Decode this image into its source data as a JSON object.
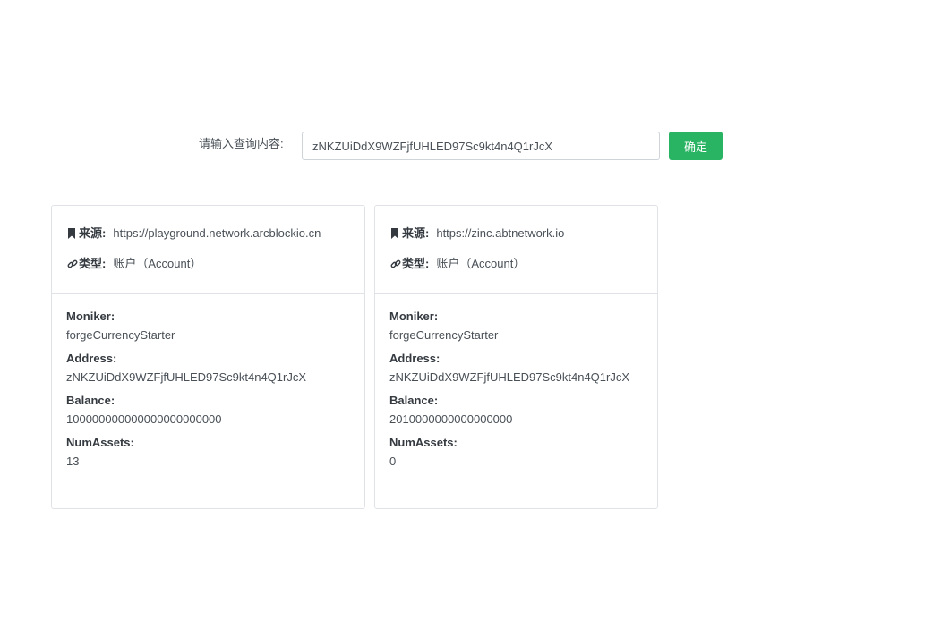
{
  "search": {
    "label": "请输入查询内容:",
    "value": "zNKZUiDdX9WZFjfUHLED97Sc9kt4n4Q1rJcX",
    "button": "确定"
  },
  "cards": [
    {
      "source_key": "来源:",
      "source_val": "https://playground.network.arcblockio.cn",
      "type_key": "类型:",
      "type_val": "账户（Account）",
      "fields": [
        {
          "label": "Moniker:",
          "value": "forgeCurrencyStarter"
        },
        {
          "label": "Address:",
          "value": "zNKZUiDdX9WZFjfUHLED97Sc9kt4n4Q1rJcX"
        },
        {
          "label": "Balance:",
          "value": "100000000000000000000000"
        },
        {
          "label": "NumAssets:",
          "value": "13"
        }
      ]
    },
    {
      "source_key": "来源:",
      "source_val": "https://zinc.abtnetwork.io",
      "type_key": "类型:",
      "type_val": "账户（Account）",
      "fields": [
        {
          "label": "Moniker:",
          "value": "forgeCurrencyStarter"
        },
        {
          "label": "Address:",
          "value": "zNKZUiDdX9WZFjfUHLED97Sc9kt4n4Q1rJcX"
        },
        {
          "label": "Balance:",
          "value": "2010000000000000000"
        },
        {
          "label": "NumAssets:",
          "value": "0"
        }
      ]
    }
  ],
  "icons": {
    "source": "bookmark-icon",
    "type": "link-icon"
  },
  "colors": {
    "button": "#28b463",
    "border": "#dfe3e7"
  }
}
